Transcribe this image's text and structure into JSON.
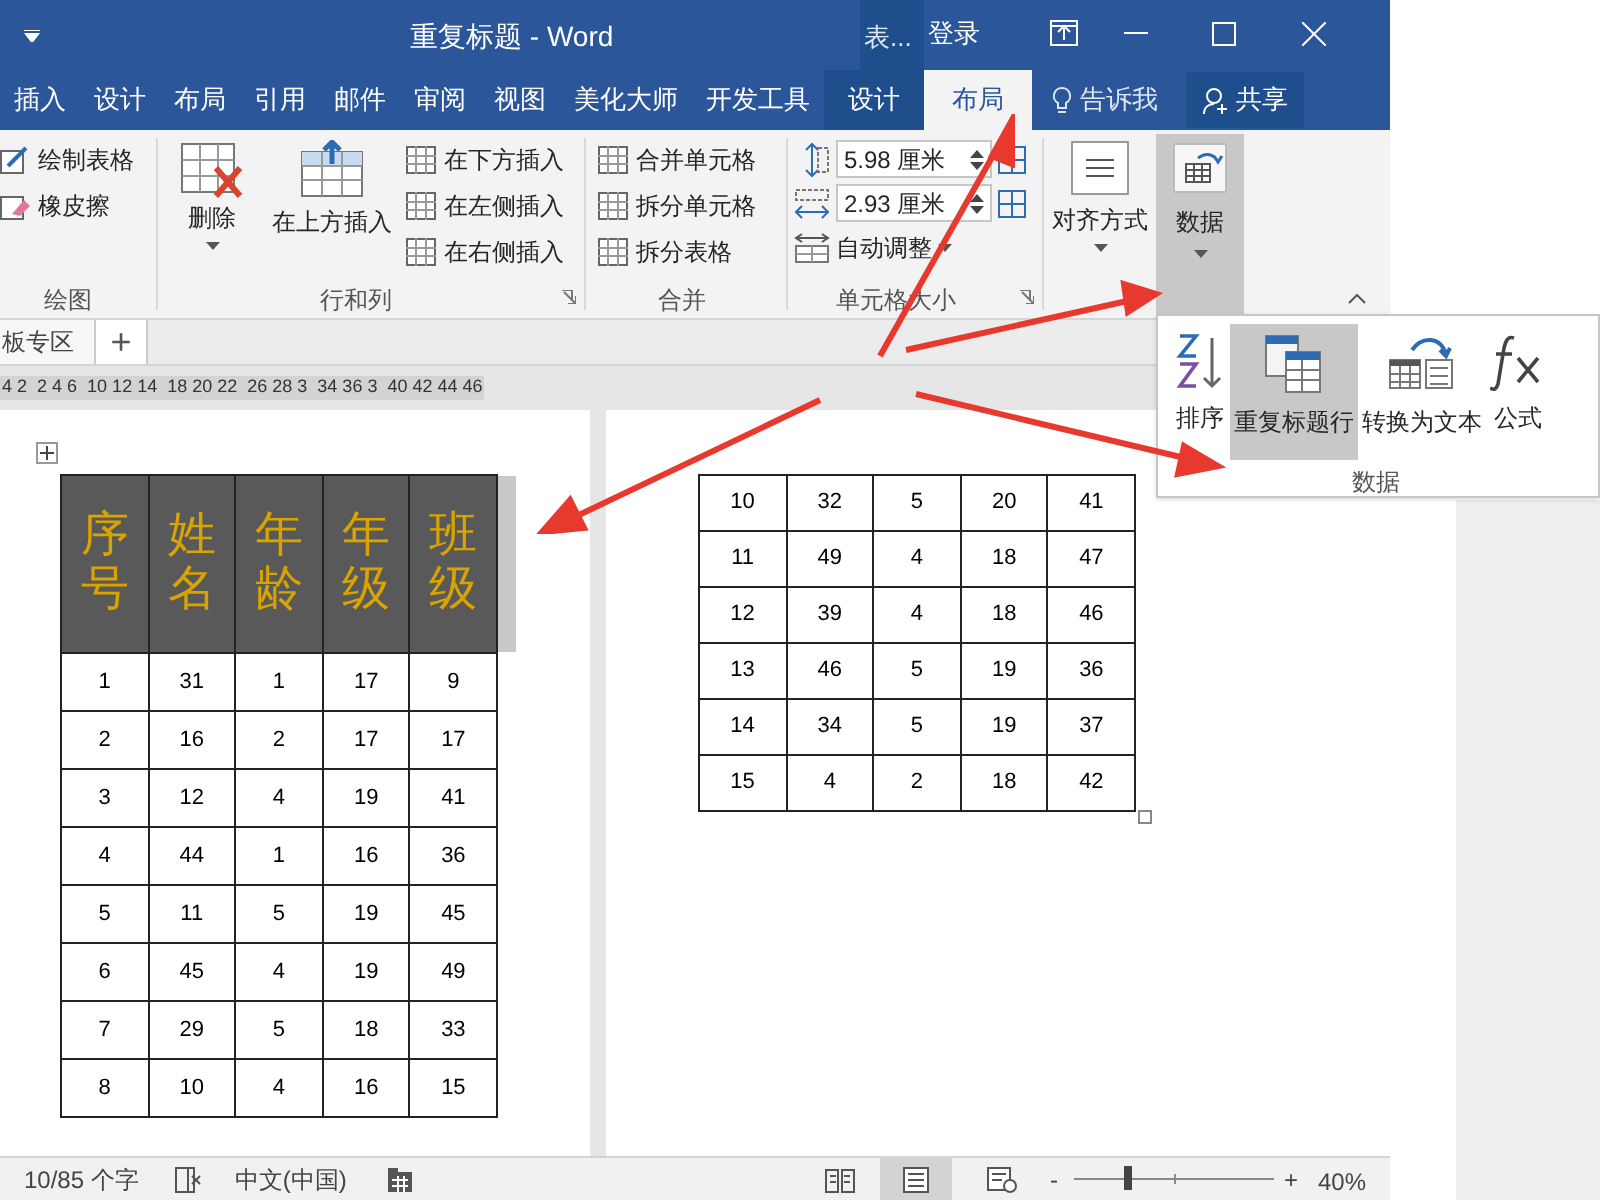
{
  "window": {
    "title": "重复标题  -  Word",
    "context_group": "表...",
    "sign_in": "登录"
  },
  "tabs": [
    {
      "label": "插入",
      "selected": false,
      "kind": "normal"
    },
    {
      "label": "设计",
      "selected": false,
      "kind": "normal"
    },
    {
      "label": "布局",
      "selected": false,
      "kind": "normal"
    },
    {
      "label": "引用",
      "selected": false,
      "kind": "normal"
    },
    {
      "label": "邮件",
      "selected": false,
      "kind": "normal"
    },
    {
      "label": "审阅",
      "selected": false,
      "kind": "normal"
    },
    {
      "label": "视图",
      "selected": false,
      "kind": "normal"
    },
    {
      "label": "美化大师",
      "selected": false,
      "kind": "normal"
    },
    {
      "label": "开发工具",
      "selected": false,
      "kind": "normal"
    },
    {
      "label": "设计",
      "selected": false,
      "kind": "context"
    },
    {
      "label": "布局",
      "selected": true,
      "kind": "context"
    }
  ],
  "tell_me": "告诉我",
  "share": "共享",
  "ribbon": {
    "draw": {
      "items": [
        "绘制表格",
        "橡皮擦"
      ],
      "label": "绘图"
    },
    "rows_cols": {
      "delete": "删除",
      "insert_above": "在上方插入",
      "items": [
        "在下方插入",
        "在左侧插入",
        "在右侧插入"
      ],
      "label": "行和列"
    },
    "merge": {
      "items": [
        "合并单元格",
        "拆分单元格",
        "拆分表格"
      ],
      "label": "合并"
    },
    "cell_size": {
      "height": "5.98 厘米",
      "width": "2.93 厘米",
      "autofit": "自动调整",
      "label": "单元格大小"
    },
    "alignment": "对齐方式",
    "data": {
      "label": "数据",
      "selected": true
    }
  },
  "data_menu": {
    "items": [
      {
        "label": "排序",
        "selected": false
      },
      {
        "label": "重复标题行",
        "selected": true
      },
      {
        "label": "转换为文本",
        "selected": false
      },
      {
        "label": "公式",
        "selected": false
      }
    ],
    "label": "数据"
  },
  "doc_tabs": {
    "tab": "板专区",
    "add": "+"
  },
  "ruler": [
    "4 2",
    "2 4 6",
    "10 12 14",
    "18 20 22",
    "26 28 3",
    "34 36 3",
    "40 42 44 46"
  ],
  "left_table": {
    "header": [
      "序号",
      "姓名",
      "年龄",
      "年级",
      "班级"
    ],
    "rows": [
      [
        "1",
        "31",
        "1",
        "17",
        "9"
      ],
      [
        "2",
        "16",
        "2",
        "17",
        "17"
      ],
      [
        "3",
        "12",
        "4",
        "19",
        "41"
      ],
      [
        "4",
        "44",
        "1",
        "16",
        "36"
      ],
      [
        "5",
        "11",
        "5",
        "19",
        "45"
      ],
      [
        "6",
        "45",
        "4",
        "19",
        "49"
      ],
      [
        "7",
        "29",
        "5",
        "18",
        "33"
      ],
      [
        "8",
        "10",
        "4",
        "16",
        "15"
      ]
    ]
  },
  "right_table": {
    "rows": [
      [
        "10",
        "32",
        "5",
        "20",
        "41"
      ],
      [
        "11",
        "49",
        "4",
        "18",
        "47"
      ],
      [
        "12",
        "39",
        "4",
        "18",
        "46"
      ],
      [
        "13",
        "46",
        "5",
        "19",
        "36"
      ],
      [
        "14",
        "34",
        "5",
        "19",
        "37"
      ],
      [
        "15",
        "4",
        "2",
        "18",
        "42"
      ]
    ]
  },
  "status_bar": {
    "word_count": "10/85 个字",
    "language": "中文(中国)",
    "zoom_minus": "-",
    "zoom_plus": "+",
    "zoom": "40%",
    "zoom_slider": {
      "level": 0.27
    }
  }
}
